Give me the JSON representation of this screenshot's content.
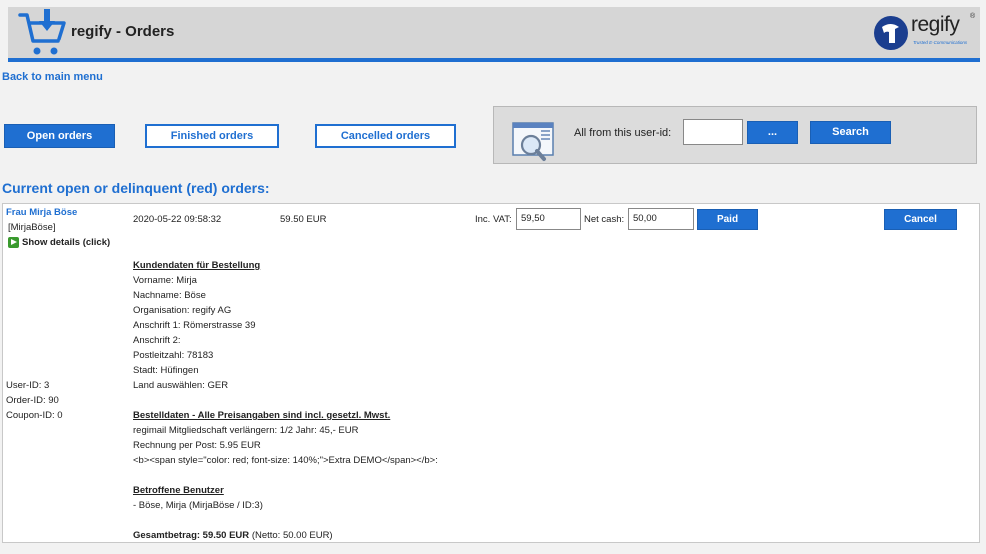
{
  "header": {
    "title": "regify - Orders",
    "logo_text": "regify",
    "logo_sub": "Trusted E-Communications",
    "logo_reg": "®"
  },
  "nav": {
    "back_link": "Back to main menu"
  },
  "tabs": {
    "open": "Open orders",
    "finished": "Finished orders",
    "cancelled": "Cancelled orders"
  },
  "search": {
    "label": "All from this user-id:",
    "input_value": "",
    "browse_button": "...",
    "search_button": "Search"
  },
  "section_title": "Current open or delinquent (red) orders:",
  "order": {
    "customer_name": "Frau Mirja Böse",
    "username": "[MirjaBöse]",
    "show_details": "Show details (click)",
    "date": "2020-05-22 09:58:32",
    "amount": "59.50 EUR",
    "inc_vat_label": "Inc. VAT:",
    "inc_vat_value": "59,50",
    "net_cash_label": "Net cash:",
    "net_cash_value": "50,00",
    "paid_button": "Paid",
    "cancel_button": "Cancel",
    "user_id": "User-ID: 3",
    "order_id": "Order-ID: 90",
    "coupon_id": "Coupon-ID: 0",
    "customer_heading": "Kundendaten für Bestellung",
    "customer_lines": [
      "Vorname: Mirja",
      "Nachname: Böse",
      "Organisation: regify AG",
      "Anschrift 1: Römerstrasse 39",
      "Anschrift 2:",
      "Postleitzahl: 78183",
      "Stadt: Hüfingen",
      "Land auswählen: GER"
    ],
    "order_heading": "Bestelldaten - Alle Preisangaben sind incl. gesetzl. Mwst.",
    "order_lines": [
      "regimail Mitgliedschaft verlängern: 1/2 Jahr: 45,- EUR",
      "Rechnung per Post: 5.95 EUR",
      "<b><span style=\"color: red; font-size: 140%;\">Extra DEMO</span></b>:"
    ],
    "users_heading": "Betroffene Benutzer",
    "users_lines": [
      "- Böse, Mirja (MirjaBöse / ID:3)"
    ],
    "total_label": "Gesamtbetrag: 59.50 EUR",
    "total_net": "(Netto: 50.00 EUR)"
  },
  "colors": {
    "accent": "#1f6fd1",
    "header_bg": "#d6d6d6",
    "paid_icon": "#3a9a2e"
  },
  "icons": {
    "cart": "cart-download-icon",
    "search": "magnifier-window-icon",
    "details": "play-icon"
  }
}
